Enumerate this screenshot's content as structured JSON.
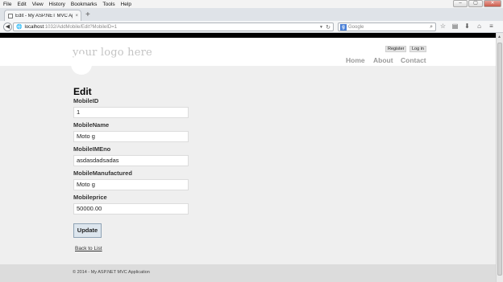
{
  "browser": {
    "menu": [
      "File",
      "Edit",
      "View",
      "History",
      "Bookmarks",
      "Tools",
      "Help"
    ],
    "window_controls": {
      "minimize": "–",
      "maximize": "▢",
      "close": "✕"
    },
    "tab": {
      "title": "Edit - My ASP.NET MVC Appli...",
      "close": "×"
    },
    "new_tab": "+",
    "url": {
      "host": "localhost",
      "path": ":1032/AddMobile/Edit?MobileID=1"
    },
    "search": {
      "placeholder": "Google"
    },
    "icons": {
      "back": "back-arrow-icon",
      "reload": "reload-icon",
      "bookmark": "star-icon",
      "downloads": "download-icon",
      "home": "home-icon",
      "menu": "hamburger-menu-icon"
    }
  },
  "site": {
    "logo": "your logo here",
    "auth": {
      "register": "Register",
      "login": "Log in"
    },
    "nav": [
      "Home",
      "About",
      "Contact"
    ]
  },
  "form": {
    "heading": "Edit",
    "fields": [
      {
        "label": "MobileID",
        "value": "1"
      },
      {
        "label": "MobileName",
        "value": "Moto g"
      },
      {
        "label": "MobileIMEno",
        "value": "asdasdadsadas"
      },
      {
        "label": "MobileManufactured",
        "value": "Moto g"
      },
      {
        "label": "Mobileprice",
        "value": "50000.00"
      }
    ],
    "submit": "Update",
    "back_link": "Back to List"
  },
  "footer": {
    "text": "© 2014 - My ASP.NET MVC Application"
  }
}
